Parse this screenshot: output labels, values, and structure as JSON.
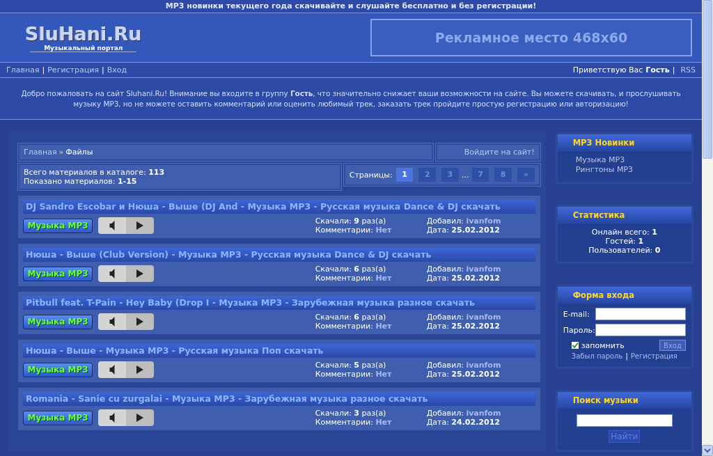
{
  "top_banner": "MP3 новинки текущего года скачивайте и слушайте бесплатно и без регистрации!",
  "logo": {
    "name": "SluHani.Ru",
    "tagline": "Музыкальный портал"
  },
  "ad_banner": "Рекламное место 468x60",
  "nav": {
    "separator": "|",
    "links": [
      {
        "label": "Главная"
      },
      {
        "label": "Регистрация"
      },
      {
        "label": "Вход"
      }
    ],
    "greeting": "Приветствую Вас",
    "user": "Гость",
    "rss": "RSS"
  },
  "welcome": "Добро пожаловать на сайт Sluhani.Ru! Внимание вы входите в группу **Гость**, что значительно снижает ваши возможности на сайте. Вы можете скачивать, и прослушивать музыку MP3, но не можете оставить комментарий или оценить любимый трек, заказать трек пройдите простую регистрацию или авторизацию!",
  "breadcrumb": {
    "home": "Главная",
    "separator": "»",
    "current": "Файлы",
    "login_link": "Войдите на сайт!"
  },
  "catalog_info": [
    {
      "label": "Всего материалов в каталоге:",
      "value": "113"
    },
    {
      "label": "Показано материалов:",
      "value": "1-15"
    }
  ],
  "pagination": {
    "label": "Страницы:",
    "items": [
      {
        "label": "1",
        "selected": true,
        "kind": "page"
      },
      {
        "label": "2",
        "selected": false,
        "kind": "page"
      },
      {
        "label": "3",
        "selected": false,
        "kind": "page"
      },
      {
        "label": "…",
        "kind": "gap"
      },
      {
        "label": "7",
        "selected": false,
        "kind": "page"
      },
      {
        "label": "8",
        "selected": false,
        "kind": "page"
      },
      {
        "label": "»",
        "selected": false,
        "kind": "page"
      }
    ]
  },
  "entries": [
    {
      "title": "DJ Sandro Escobar и Нюша - Выше (DJ And - Музыка MP3 - Русская музыка Dance & DJ скачать",
      "category": "Музыка MP3",
      "downloads": {
        "label": "Скачали:",
        "value": "9",
        "unit": "раз(а)"
      },
      "comments": {
        "label": "Комментарии:",
        "value": "Нет"
      },
      "added_by": {
        "label": "Добавил:",
        "value": "ivanfom"
      },
      "date": {
        "label": "Дата:",
        "value": "25.02.2012"
      }
    },
    {
      "title": "Нюша - Выше (Club Version) - Музыка MP3 - Русская музыка Dance & DJ скачать",
      "category": "Музыка MP3",
      "downloads": {
        "label": "Скачали:",
        "value": "6",
        "unit": "раз(а)"
      },
      "comments": {
        "label": "Комментарии:",
        "value": "Нет"
      },
      "added_by": {
        "label": "Добавил:",
        "value": "ivanfom"
      },
      "date": {
        "label": "Дата:",
        "value": "25.02.2012"
      }
    },
    {
      "title": "Pitbull feat. T-Pain - Hey Baby (Drop I - Музыка MP3 - Зарубежная музыка разное скачать",
      "category": "Музыка MP3",
      "downloads": {
        "label": "Скачали:",
        "value": "6",
        "unit": "раз(а)"
      },
      "comments": {
        "label": "Комментарии:",
        "value": "Нет"
      },
      "added_by": {
        "label": "Добавил:",
        "value": "ivanfom"
      },
      "date": {
        "label": "Дата:",
        "value": "25.02.2012"
      }
    },
    {
      "title": "Нюша - Выше - Музыка MP3 - Русская музыка Поп скачать",
      "category": "Музыка MP3",
      "downloads": {
        "label": "Скачали:",
        "value": "5",
        "unit": "раз(а)"
      },
      "comments": {
        "label": "Комментарии:",
        "value": "Нет"
      },
      "added_by": {
        "label": "Добавил:",
        "value": "ivanfom"
      },
      "date": {
        "label": "Дата:",
        "value": "25.02.2012"
      }
    },
    {
      "title": "Romania - Sanie cu zurgalai - Музыка MP3 - Зарубежная музыка разное скачать",
      "category": "Музыка MP3",
      "downloads": {
        "label": "Скачали:",
        "value": "3",
        "unit": "раз(а)"
      },
      "comments": {
        "label": "Комментарии:",
        "value": "Нет"
      },
      "added_by": {
        "label": "Добавил:",
        "value": "ivanfom"
      },
      "date": {
        "label": "Дата:",
        "value": "24.02.2012"
      }
    }
  ],
  "sidebar": {
    "new_mp3": {
      "title": "MP3 Новинки",
      "links": [
        "Музыка MP3",
        "Рингтоны MP3"
      ]
    },
    "stats": {
      "title": "Статистика",
      "rows": [
        {
          "label": "Онлайн всего:",
          "value": "1"
        },
        {
          "label": "Гостей:",
          "value": "1"
        },
        {
          "label": "Пользователей:",
          "value": "0"
        }
      ]
    },
    "login": {
      "title": "Форма входа",
      "email_label": "E-mail:",
      "password_label": "Пароль:",
      "remember": {
        "label": "запомнить",
        "checked": true
      },
      "submit": "Вход",
      "separator": "|",
      "forgot": "Забыл пароль",
      "register": "Регистрация"
    },
    "search": {
      "title": "Поиск музыки",
      "button": "Найти"
    }
  }
}
